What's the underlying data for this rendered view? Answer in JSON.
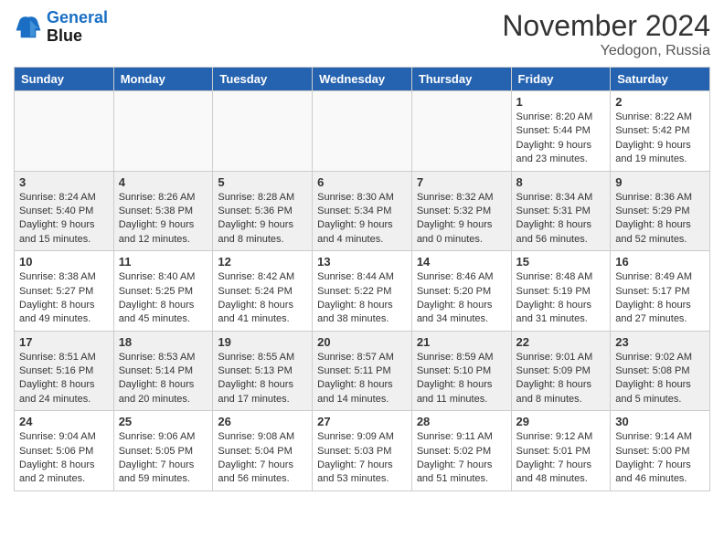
{
  "header": {
    "logo_line1": "General",
    "logo_line2": "Blue",
    "month_title": "November 2024",
    "location": "Yedogon, Russia"
  },
  "weekdays": [
    "Sunday",
    "Monday",
    "Tuesday",
    "Wednesday",
    "Thursday",
    "Friday",
    "Saturday"
  ],
  "weeks": [
    [
      {
        "day": "",
        "info": ""
      },
      {
        "day": "",
        "info": ""
      },
      {
        "day": "",
        "info": ""
      },
      {
        "day": "",
        "info": ""
      },
      {
        "day": "",
        "info": ""
      },
      {
        "day": "1",
        "info": "Sunrise: 8:20 AM\nSunset: 5:44 PM\nDaylight: 9 hours\nand 23 minutes."
      },
      {
        "day": "2",
        "info": "Sunrise: 8:22 AM\nSunset: 5:42 PM\nDaylight: 9 hours\nand 19 minutes."
      }
    ],
    [
      {
        "day": "3",
        "info": "Sunrise: 8:24 AM\nSunset: 5:40 PM\nDaylight: 9 hours\nand 15 minutes."
      },
      {
        "day": "4",
        "info": "Sunrise: 8:26 AM\nSunset: 5:38 PM\nDaylight: 9 hours\nand 12 minutes."
      },
      {
        "day": "5",
        "info": "Sunrise: 8:28 AM\nSunset: 5:36 PM\nDaylight: 9 hours\nand 8 minutes."
      },
      {
        "day": "6",
        "info": "Sunrise: 8:30 AM\nSunset: 5:34 PM\nDaylight: 9 hours\nand 4 minutes."
      },
      {
        "day": "7",
        "info": "Sunrise: 8:32 AM\nSunset: 5:32 PM\nDaylight: 9 hours\nand 0 minutes."
      },
      {
        "day": "8",
        "info": "Sunrise: 8:34 AM\nSunset: 5:31 PM\nDaylight: 8 hours\nand 56 minutes."
      },
      {
        "day": "9",
        "info": "Sunrise: 8:36 AM\nSunset: 5:29 PM\nDaylight: 8 hours\nand 52 minutes."
      }
    ],
    [
      {
        "day": "10",
        "info": "Sunrise: 8:38 AM\nSunset: 5:27 PM\nDaylight: 8 hours\nand 49 minutes."
      },
      {
        "day": "11",
        "info": "Sunrise: 8:40 AM\nSunset: 5:25 PM\nDaylight: 8 hours\nand 45 minutes."
      },
      {
        "day": "12",
        "info": "Sunrise: 8:42 AM\nSunset: 5:24 PM\nDaylight: 8 hours\nand 41 minutes."
      },
      {
        "day": "13",
        "info": "Sunrise: 8:44 AM\nSunset: 5:22 PM\nDaylight: 8 hours\nand 38 minutes."
      },
      {
        "day": "14",
        "info": "Sunrise: 8:46 AM\nSunset: 5:20 PM\nDaylight: 8 hours\nand 34 minutes."
      },
      {
        "day": "15",
        "info": "Sunrise: 8:48 AM\nSunset: 5:19 PM\nDaylight: 8 hours\nand 31 minutes."
      },
      {
        "day": "16",
        "info": "Sunrise: 8:49 AM\nSunset: 5:17 PM\nDaylight: 8 hours\nand 27 minutes."
      }
    ],
    [
      {
        "day": "17",
        "info": "Sunrise: 8:51 AM\nSunset: 5:16 PM\nDaylight: 8 hours\nand 24 minutes."
      },
      {
        "day": "18",
        "info": "Sunrise: 8:53 AM\nSunset: 5:14 PM\nDaylight: 8 hours\nand 20 minutes."
      },
      {
        "day": "19",
        "info": "Sunrise: 8:55 AM\nSunset: 5:13 PM\nDaylight: 8 hours\nand 17 minutes."
      },
      {
        "day": "20",
        "info": "Sunrise: 8:57 AM\nSunset: 5:11 PM\nDaylight: 8 hours\nand 14 minutes."
      },
      {
        "day": "21",
        "info": "Sunrise: 8:59 AM\nSunset: 5:10 PM\nDaylight: 8 hours\nand 11 minutes."
      },
      {
        "day": "22",
        "info": "Sunrise: 9:01 AM\nSunset: 5:09 PM\nDaylight: 8 hours\nand 8 minutes."
      },
      {
        "day": "23",
        "info": "Sunrise: 9:02 AM\nSunset: 5:08 PM\nDaylight: 8 hours\nand 5 minutes."
      }
    ],
    [
      {
        "day": "24",
        "info": "Sunrise: 9:04 AM\nSunset: 5:06 PM\nDaylight: 8 hours\nand 2 minutes."
      },
      {
        "day": "25",
        "info": "Sunrise: 9:06 AM\nSunset: 5:05 PM\nDaylight: 7 hours\nand 59 minutes."
      },
      {
        "day": "26",
        "info": "Sunrise: 9:08 AM\nSunset: 5:04 PM\nDaylight: 7 hours\nand 56 minutes."
      },
      {
        "day": "27",
        "info": "Sunrise: 9:09 AM\nSunset: 5:03 PM\nDaylight: 7 hours\nand 53 minutes."
      },
      {
        "day": "28",
        "info": "Sunrise: 9:11 AM\nSunset: 5:02 PM\nDaylight: 7 hours\nand 51 minutes."
      },
      {
        "day": "29",
        "info": "Sunrise: 9:12 AM\nSunset: 5:01 PM\nDaylight: 7 hours\nand 48 minutes."
      },
      {
        "day": "30",
        "info": "Sunrise: 9:14 AM\nSunset: 5:00 PM\nDaylight: 7 hours\nand 46 minutes."
      }
    ]
  ]
}
